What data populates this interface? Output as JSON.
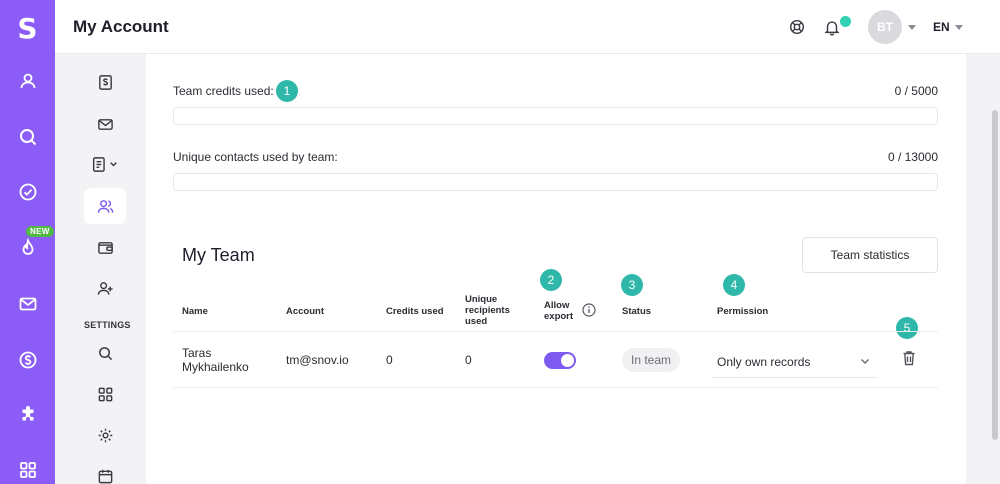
{
  "rail": {
    "logo": "S",
    "new_badge": "NEW",
    "items": [
      "profile-icon",
      "search-icon",
      "check-circle-icon",
      "flame-icon",
      "mail-icon",
      "dollar-icon",
      "puzzle-icon",
      "apps-icon"
    ]
  },
  "header": {
    "title": "My Account",
    "avatar_initials": "BT",
    "language": "EN"
  },
  "subnav": {
    "settings_label": "SETTINGS"
  },
  "credits": {
    "team_label": "Team credits used:",
    "team_value": "0 / 5000",
    "team_progress": 0,
    "contacts_label": "Unique contacts used by team:",
    "contacts_value": "0 / 13000",
    "contacts_progress": 0
  },
  "team": {
    "title": "My Team",
    "stats_button": "Team statistics",
    "columns": {
      "name": "Name",
      "account": "Account",
      "credits": "Credits used",
      "unique_1": "Unique",
      "unique_2": "recipients",
      "unique_3": "used",
      "export_1": "Allow",
      "export_2": "export",
      "status": "Status",
      "permission": "Permission"
    },
    "rows": [
      {
        "name_1": "Taras",
        "name_2": "Mykhailenko",
        "account": "tm@snov.io",
        "credits_used": "0",
        "unique_recipients": "0",
        "allow_export": true,
        "status": "In team",
        "permission": "Only own records"
      }
    ]
  },
  "markers": [
    "1",
    "2",
    "3",
    "4",
    "5"
  ],
  "colors": {
    "brand": "#8b5cf6",
    "marker": "#2fb8a9",
    "notification": "#32d1b2",
    "new_badge": "#52b947"
  }
}
